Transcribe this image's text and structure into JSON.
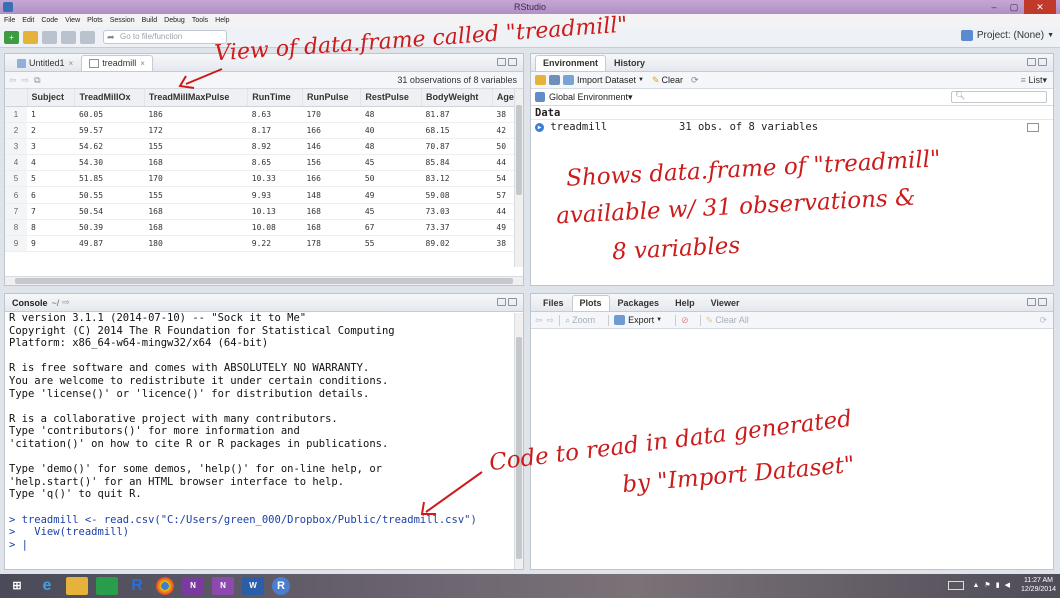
{
  "window": {
    "title": "RStudio"
  },
  "menu": [
    "File",
    "Edit",
    "Code",
    "View",
    "Plots",
    "Session",
    "Build",
    "Debug",
    "Tools",
    "Help"
  ],
  "toolbar": {
    "goto_placeholder": "Go to file/function",
    "project_label": "Project: (None)"
  },
  "source_pane": {
    "tabs": [
      {
        "label": "Untitled1",
        "active": false
      },
      {
        "label": "treadmill",
        "active": true
      }
    ],
    "summary": "31 observations of 8 variables",
    "columns": [
      "",
      "Subject",
      "TreadMillOx",
      "TreadMillMaxPulse",
      "RunTime",
      "RunPulse",
      "RestPulse",
      "BodyWeight",
      "Age"
    ],
    "rows": [
      [
        "1",
        "1",
        "60.05",
        "186",
        "8.63",
        "170",
        "48",
        "81.87",
        "38"
      ],
      [
        "2",
        "2",
        "59.57",
        "172",
        "8.17",
        "166",
        "40",
        "68.15",
        "42"
      ],
      [
        "3",
        "3",
        "54.62",
        "155",
        "8.92",
        "146",
        "48",
        "70.87",
        "50"
      ],
      [
        "4",
        "4",
        "54.30",
        "168",
        "8.65",
        "156",
        "45",
        "85.84",
        "44"
      ],
      [
        "5",
        "5",
        "51.85",
        "170",
        "10.33",
        "166",
        "50",
        "83.12",
        "54"
      ],
      [
        "6",
        "6",
        "50.55",
        "155",
        "9.93",
        "148",
        "49",
        "59.08",
        "57"
      ],
      [
        "7",
        "7",
        "50.54",
        "168",
        "10.13",
        "168",
        "45",
        "73.03",
        "44"
      ],
      [
        "8",
        "8",
        "50.39",
        "168",
        "10.08",
        "168",
        "67",
        "73.37",
        "49"
      ],
      [
        "9",
        "9",
        "49.87",
        "180",
        "9.22",
        "178",
        "55",
        "89.02",
        "38"
      ]
    ]
  },
  "environment_pane": {
    "tabs": [
      "Environment",
      "History"
    ],
    "import_label": "Import Dataset",
    "clear_label": "Clear",
    "list_label": "List",
    "scope_label": "Global Environment",
    "section_label": "Data",
    "items": [
      {
        "name": "treadmill",
        "value": "31 obs. of 8 variables"
      }
    ]
  },
  "console_pane": {
    "title": "Console",
    "path": "~/",
    "lines": [
      "R version 3.1.1 (2014-07-10) -- \"Sock it to Me\"",
      "Copyright (C) 2014 The R Foundation for Statistical Computing",
      "Platform: x86_64-w64-mingw32/x64 (64-bit)",
      "",
      "R is free software and comes with ABSOLUTELY NO WARRANTY.",
      "You are welcome to redistribute it under certain conditions.",
      "Type 'license()' or 'licence()' for distribution details.",
      "",
      "R is a collaborative project with many contributors.",
      "Type 'contributors()' for more information and",
      "'citation()' on how to cite R or R packages in publications.",
      "",
      "Type 'demo()' for some demos, 'help()' for on-line help, or",
      "'help.start()' for an HTML browser interface to help.",
      "Type 'q()' to quit R.",
      ""
    ],
    "commands": [
      "> treadmill <- read.csv(\"C:/Users/green_000/Dropbox/Public/treadmill.csv\")",
      ">   View(treadmill)",
      "> |"
    ]
  },
  "files_pane": {
    "tabs": [
      "Files",
      "Plots",
      "Packages",
      "Help",
      "Viewer"
    ],
    "active_tab": "Plots",
    "zoom_label": "Zoom",
    "export_label": "Export",
    "clear_all_label": "Clear All"
  },
  "annotations": {
    "viewer_note": "View of data.frame called \"treadmill\"",
    "env_note_1": "Shows data.frame of \"treadmill\"",
    "env_note_2": "available w/ 31 observations &",
    "env_note_3": "8 variables",
    "code_note_1": "Code to read in data generated",
    "code_note_2": "by \"Import Dataset\""
  },
  "taskbar": {
    "time": "11:27 AM",
    "date": "12/29/2014"
  },
  "colors": {
    "annotation": "#cc1b1b",
    "title_bar": "#b08fc4",
    "console_command": "#1b3fa8"
  }
}
